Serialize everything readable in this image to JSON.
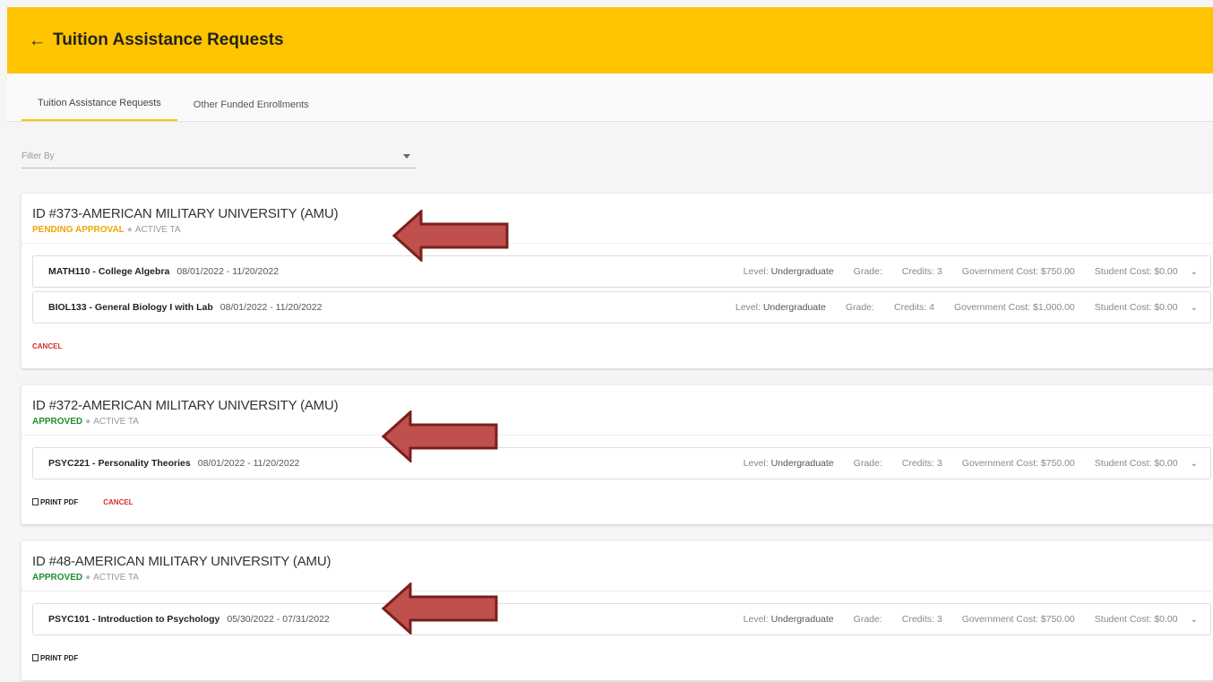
{
  "header": {
    "title": "Tuition Assistance Requests",
    "back_icon": "arrow-left-icon"
  },
  "tabs": [
    {
      "label": "Tuition Assistance Requests",
      "active": true
    },
    {
      "label": "Other Funded Enrollments",
      "active": false
    }
  ],
  "filter": {
    "placeholder": "Filter By"
  },
  "requests": [
    {
      "title": "ID #373-AMERICAN MILITARY UNIVERSITY (AMU)",
      "status": "PENDING APPROVAL",
      "status_color": "#f0a500",
      "tag": "ACTIVE TA",
      "courses": [
        {
          "name": "MATH110 - College Algebra",
          "dates": "08/01/2022 - 11/20/2022",
          "level_label": "Level:",
          "level": "Undergraduate",
          "grade": "Grade:",
          "credits": "Credits: 3",
          "gov_cost": "Government Cost: $750.00",
          "student_cost": "Student Cost: $0.00"
        },
        {
          "name": "BIOL133 - General Biology I with Lab",
          "dates": "08/01/2022 - 11/20/2022",
          "level_label": "Level:",
          "level": "Undergraduate",
          "grade": "Grade:",
          "credits": "Credits: 4",
          "gov_cost": "Government Cost: $1,000.00",
          "student_cost": "Student Cost: $0.00"
        }
      ],
      "actions": {
        "cancel": "CANCEL"
      }
    },
    {
      "title": "ID #372-AMERICAN MILITARY UNIVERSITY (AMU)",
      "status": "APPROVED",
      "status_color": "#1e8f2e",
      "tag": "ACTIVE TA",
      "courses": [
        {
          "name": "PSYC221 - Personality Theories",
          "dates": "08/01/2022 - 11/20/2022",
          "level_label": "Level:",
          "level": "Undergraduate",
          "grade": "Grade:",
          "credits": "Credits: 3",
          "gov_cost": "Government Cost: $750.00",
          "student_cost": "Student Cost: $0.00"
        }
      ],
      "actions": {
        "print": "PRINT PDF",
        "cancel": "CANCEL"
      }
    },
    {
      "title": "ID #48-AMERICAN MILITARY UNIVERSITY (AMU)",
      "status": "APPROVED",
      "status_color": "#1e8f2e",
      "tag": "ACTIVE TA",
      "courses": [
        {
          "name": "PSYC101 - Introduction to Psychology",
          "dates": "05/30/2022 - 07/31/2022",
          "level_label": "Level:",
          "level": "Undergraduate",
          "grade": "Grade:",
          "credits": "Credits: 3",
          "gov_cost": "Government Cost: $750.00",
          "student_cost": "Student Cost: $0.00"
        }
      ],
      "actions": {
        "print": "PRINT PDF"
      }
    }
  ],
  "annotation_color": "#c0504d"
}
